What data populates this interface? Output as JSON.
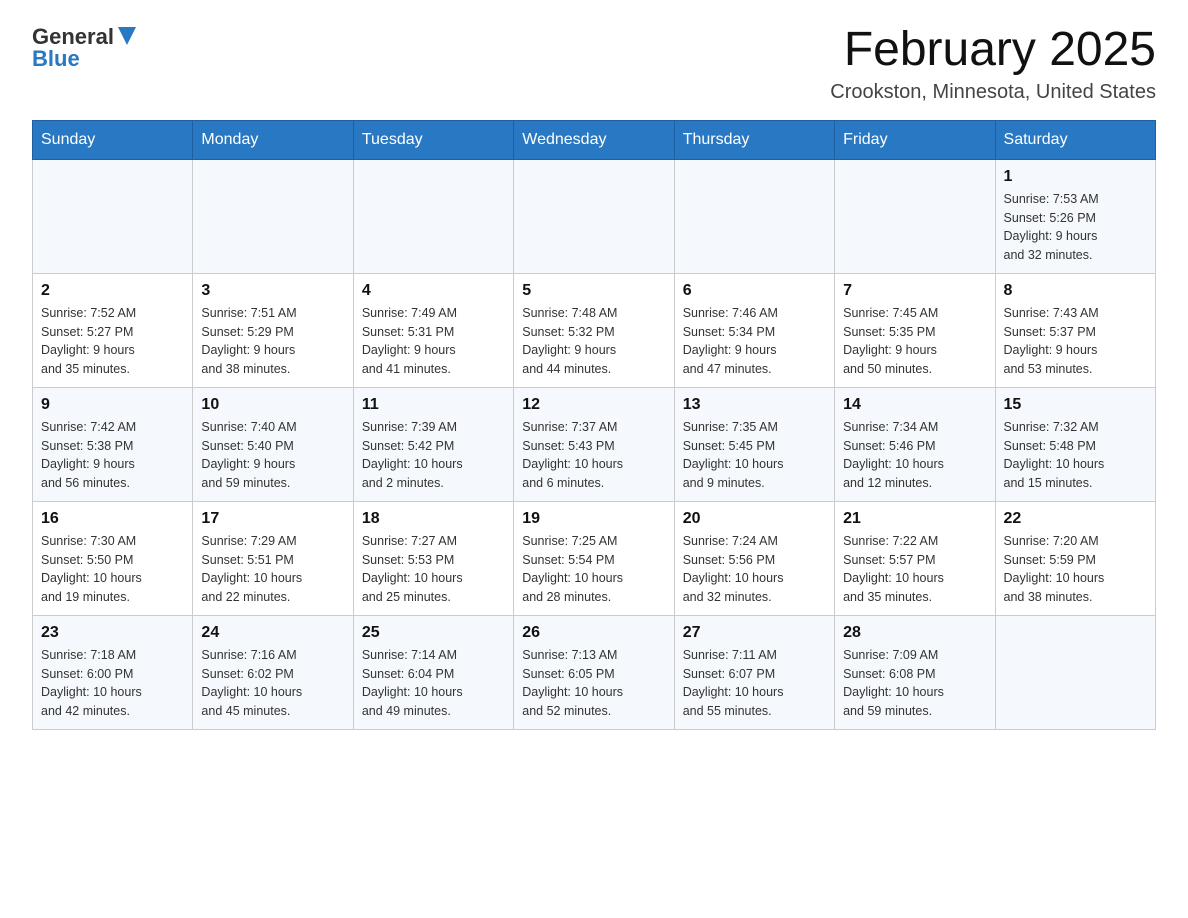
{
  "header": {
    "logo_general": "General",
    "logo_blue": "Blue",
    "month_title": "February 2025",
    "location": "Crookston, Minnesota, United States"
  },
  "weekdays": [
    "Sunday",
    "Monday",
    "Tuesday",
    "Wednesday",
    "Thursday",
    "Friday",
    "Saturday"
  ],
  "rows": [
    {
      "cells": [
        {
          "day": "",
          "info": ""
        },
        {
          "day": "",
          "info": ""
        },
        {
          "day": "",
          "info": ""
        },
        {
          "day": "",
          "info": ""
        },
        {
          "day": "",
          "info": ""
        },
        {
          "day": "",
          "info": ""
        },
        {
          "day": "1",
          "info": "Sunrise: 7:53 AM\nSunset: 5:26 PM\nDaylight: 9 hours\nand 32 minutes."
        }
      ]
    },
    {
      "cells": [
        {
          "day": "2",
          "info": "Sunrise: 7:52 AM\nSunset: 5:27 PM\nDaylight: 9 hours\nand 35 minutes."
        },
        {
          "day": "3",
          "info": "Sunrise: 7:51 AM\nSunset: 5:29 PM\nDaylight: 9 hours\nand 38 minutes."
        },
        {
          "day": "4",
          "info": "Sunrise: 7:49 AM\nSunset: 5:31 PM\nDaylight: 9 hours\nand 41 minutes."
        },
        {
          "day": "5",
          "info": "Sunrise: 7:48 AM\nSunset: 5:32 PM\nDaylight: 9 hours\nand 44 minutes."
        },
        {
          "day": "6",
          "info": "Sunrise: 7:46 AM\nSunset: 5:34 PM\nDaylight: 9 hours\nand 47 minutes."
        },
        {
          "day": "7",
          "info": "Sunrise: 7:45 AM\nSunset: 5:35 PM\nDaylight: 9 hours\nand 50 minutes."
        },
        {
          "day": "8",
          "info": "Sunrise: 7:43 AM\nSunset: 5:37 PM\nDaylight: 9 hours\nand 53 minutes."
        }
      ]
    },
    {
      "cells": [
        {
          "day": "9",
          "info": "Sunrise: 7:42 AM\nSunset: 5:38 PM\nDaylight: 9 hours\nand 56 minutes."
        },
        {
          "day": "10",
          "info": "Sunrise: 7:40 AM\nSunset: 5:40 PM\nDaylight: 9 hours\nand 59 minutes."
        },
        {
          "day": "11",
          "info": "Sunrise: 7:39 AM\nSunset: 5:42 PM\nDaylight: 10 hours\nand 2 minutes."
        },
        {
          "day": "12",
          "info": "Sunrise: 7:37 AM\nSunset: 5:43 PM\nDaylight: 10 hours\nand 6 minutes."
        },
        {
          "day": "13",
          "info": "Sunrise: 7:35 AM\nSunset: 5:45 PM\nDaylight: 10 hours\nand 9 minutes."
        },
        {
          "day": "14",
          "info": "Sunrise: 7:34 AM\nSunset: 5:46 PM\nDaylight: 10 hours\nand 12 minutes."
        },
        {
          "day": "15",
          "info": "Sunrise: 7:32 AM\nSunset: 5:48 PM\nDaylight: 10 hours\nand 15 minutes."
        }
      ]
    },
    {
      "cells": [
        {
          "day": "16",
          "info": "Sunrise: 7:30 AM\nSunset: 5:50 PM\nDaylight: 10 hours\nand 19 minutes."
        },
        {
          "day": "17",
          "info": "Sunrise: 7:29 AM\nSunset: 5:51 PM\nDaylight: 10 hours\nand 22 minutes."
        },
        {
          "day": "18",
          "info": "Sunrise: 7:27 AM\nSunset: 5:53 PM\nDaylight: 10 hours\nand 25 minutes."
        },
        {
          "day": "19",
          "info": "Sunrise: 7:25 AM\nSunset: 5:54 PM\nDaylight: 10 hours\nand 28 minutes."
        },
        {
          "day": "20",
          "info": "Sunrise: 7:24 AM\nSunset: 5:56 PM\nDaylight: 10 hours\nand 32 minutes."
        },
        {
          "day": "21",
          "info": "Sunrise: 7:22 AM\nSunset: 5:57 PM\nDaylight: 10 hours\nand 35 minutes."
        },
        {
          "day": "22",
          "info": "Sunrise: 7:20 AM\nSunset: 5:59 PM\nDaylight: 10 hours\nand 38 minutes."
        }
      ]
    },
    {
      "cells": [
        {
          "day": "23",
          "info": "Sunrise: 7:18 AM\nSunset: 6:00 PM\nDaylight: 10 hours\nand 42 minutes."
        },
        {
          "day": "24",
          "info": "Sunrise: 7:16 AM\nSunset: 6:02 PM\nDaylight: 10 hours\nand 45 minutes."
        },
        {
          "day": "25",
          "info": "Sunrise: 7:14 AM\nSunset: 6:04 PM\nDaylight: 10 hours\nand 49 minutes."
        },
        {
          "day": "26",
          "info": "Sunrise: 7:13 AM\nSunset: 6:05 PM\nDaylight: 10 hours\nand 52 minutes."
        },
        {
          "day": "27",
          "info": "Sunrise: 7:11 AM\nSunset: 6:07 PM\nDaylight: 10 hours\nand 55 minutes."
        },
        {
          "day": "28",
          "info": "Sunrise: 7:09 AM\nSunset: 6:08 PM\nDaylight: 10 hours\nand 59 minutes."
        },
        {
          "day": "",
          "info": ""
        }
      ]
    }
  ]
}
